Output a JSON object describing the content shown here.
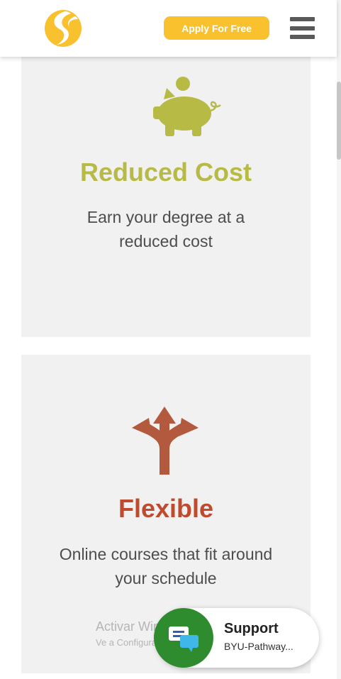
{
  "header": {
    "logo_icon": "swirl-logo-icon",
    "apply_label": "Apply For Free",
    "menu_icon": "hamburger-menu-icon"
  },
  "colors": {
    "accent_yellow": "#f9c12e",
    "reduced_cost_green": "#b7bb45",
    "flexible_rust": "#c04a2d",
    "support_green": "#2e8b2e",
    "card_bg": "#f1f1f1"
  },
  "cards": [
    {
      "icon": "piggy-bank-icon",
      "title": "Reduced Cost",
      "description": "Earn your degree at a reduced cost"
    },
    {
      "icon": "split-arrows-icon",
      "title": "Flexible",
      "description": "Online courses that fit around your schedule"
    }
  ],
  "watermark": {
    "line1": "Activar Windows",
    "line2": "Ve a Configuración para activar Windows."
  },
  "support": {
    "icon": "chat-bubbles-icon",
    "title": "Support",
    "subtitle": "BYU-Pathway..."
  }
}
